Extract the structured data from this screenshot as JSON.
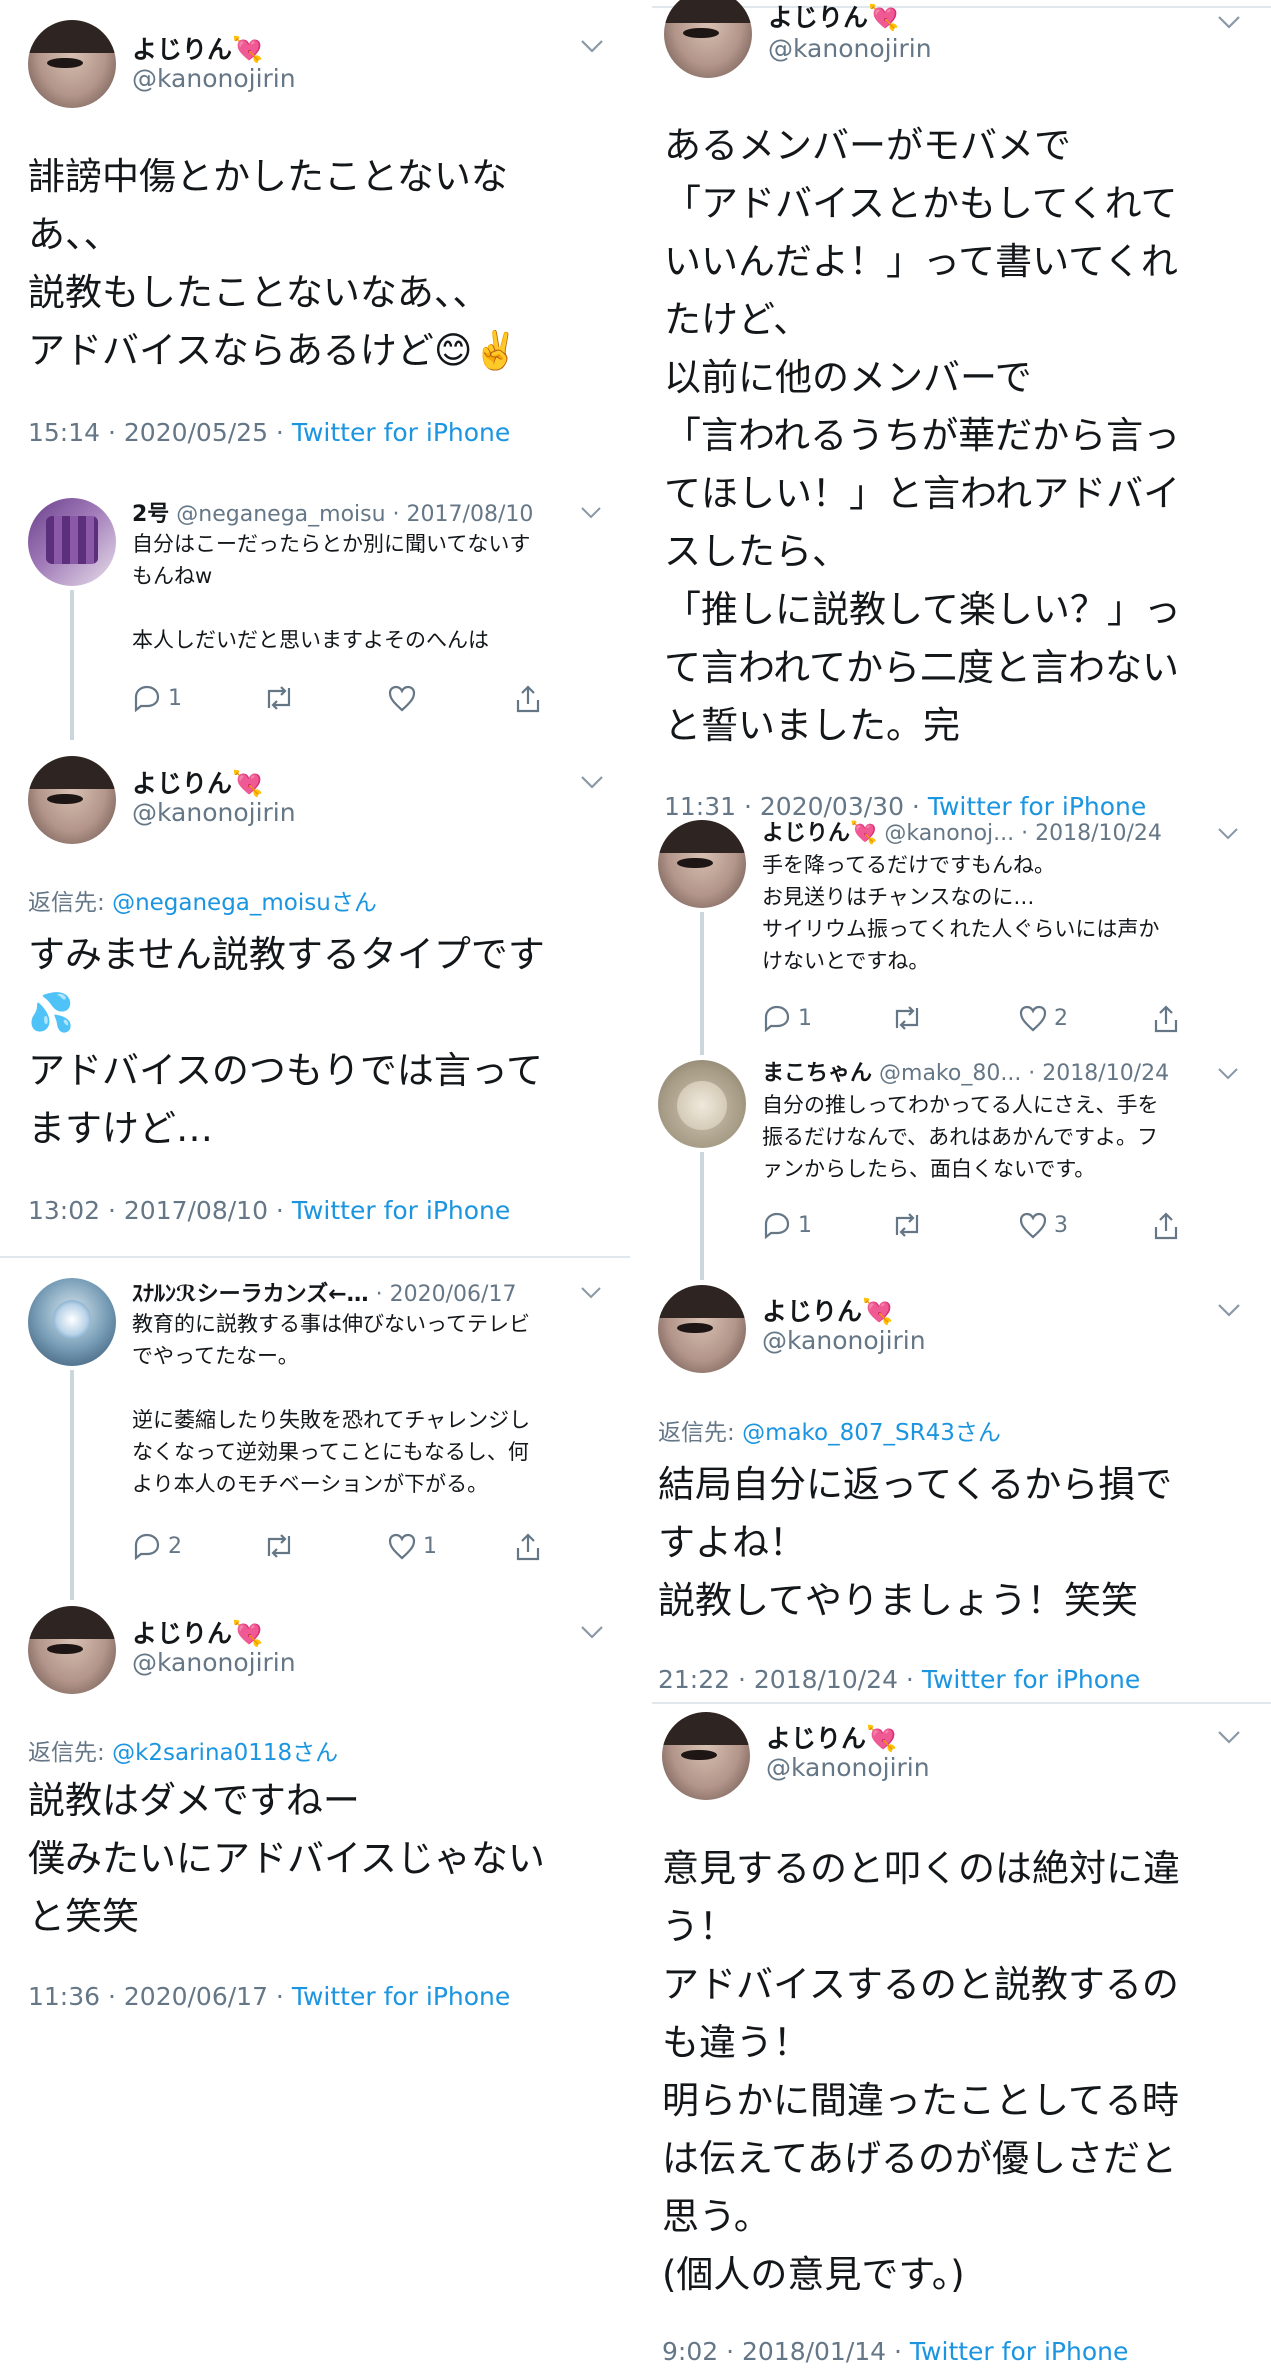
{
  "client_label": "Twitter for iPhone",
  "left": {
    "tweet1": {
      "name": "よじりん",
      "name_emoji": "💘",
      "handle": "@kanonojirin",
      "text": "誹謗中傷とかしたことないな\nあ、、\n説教もしたことないなあ、、\nアドバイスならあるけど😊✌️",
      "meta": "15:14 · 2020/05/25 · "
    },
    "reply_2go": {
      "name": "2号",
      "handle_date": " @neganega_moisu · 2017/08/10",
      "text": "自分はこーだったらとか別に聞いてないす\nもんねw\n\n本人しだいだと思いますよそのへんは",
      "reply_count": "1",
      "retweet_count": "",
      "like_count": ""
    },
    "tweet2": {
      "name": "よじりん",
      "name_emoji": "💘",
      "handle": "@kanonojirin",
      "reply_to_prefix": "返信先: ",
      "reply_to_mention": "@neganega_moisuさん",
      "text": "すみません説教するタイプです\n💦\nアドバイスのつもりでは言って\nますけど…",
      "meta": "13:02 · 2017/08/10 · "
    },
    "reply_shira": {
      "name": "ｽﾅﾙﾝℛシーラカンズ←…",
      "handle_date": " · 2020/06/17",
      "text": "教育的に説教する事は伸びないってテレビ\nでやってたなー。\n\n逆に萎縮したり失敗を恐れてチャレンジし\nなくなって逆効果ってことにもなるし、何\nより本人のモチベーションが下がる。",
      "reply_count": "2",
      "retweet_count": "",
      "like_count": "1"
    },
    "tweet3": {
      "name": "よじりん",
      "name_emoji": "💘",
      "handle": "@kanonojirin",
      "reply_to_prefix": "返信先: ",
      "reply_to_mention": "@k2sarina0118さん",
      "text": "説教はダメですねー\n僕みたいにアドバイスじゃない\nと笑笑",
      "meta": "11:36 · 2020/06/17 · "
    }
  },
  "right": {
    "tweet4": {
      "name": "よじりん",
      "name_emoji": "💘",
      "handle": "@kanonojirin",
      "text": "あるメンバーがモバメで\n「アドバイスとかもしてくれて\nいいんだよ！」って書いてくれ\nたけど、\n以前に他のメンバーで\n「言われるうちが華だから言っ\nてほしい！」と言われアドバイ\nスしたら、\n「推しに説教して楽しい？」っ\nて言われてから二度と言わない\nと誓いました。完",
      "meta": "11:31 · 2020/03/30 · "
    },
    "reply_yoji": {
      "name": "よじりん",
      "name_emoji": "💘",
      "handle_date": " @kanonoj... · 2018/10/24",
      "text": "手を降ってるだけですもんね。\nお見送りはチャンスなのに…\nサイリウム振ってくれた人ぐらいには声か\nけないとですね。",
      "reply_count": "1",
      "retweet_count": "",
      "like_count": "2"
    },
    "reply_mako": {
      "name": "まこちゃん",
      "handle_date": " @mako_80... · 2018/10/24",
      "text": "自分の推しってわかってる人にさえ、手を\n振るだけなんで、あれはあかんですよ。フ\nァンからしたら、面白くないです。",
      "reply_count": "1",
      "retweet_count": "",
      "like_count": "3"
    },
    "tweet5": {
      "name": "よじりん",
      "name_emoji": "💘",
      "handle": "@kanonojirin",
      "reply_to_prefix": "返信先: ",
      "reply_to_mention": "@mako_807_SR43さん",
      "text": "結局自分に返ってくるから損で\nすよね！\n説教してやりましょう！笑笑",
      "meta": "21:22 · 2018/10/24 · "
    },
    "tweet6": {
      "name": "よじりん",
      "name_emoji": "💘",
      "handle": "@kanonojirin",
      "text": "意見するのと叩くのは絶対に違\nう！\nアドバイスするのと説教するの\nも違う！\n明らかに間違ったことしてる時\nは伝えてあげるのが優しさだと\n思う。\n(個人の意見です。)",
      "meta": "9:02 · 2018/01/14 · "
    }
  }
}
